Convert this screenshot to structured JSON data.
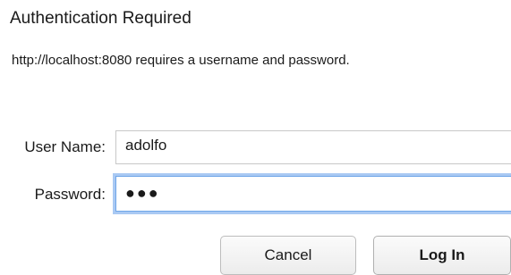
{
  "dialog": {
    "title": "Authentication Required",
    "message": "http://localhost:8080 requires a username and password."
  },
  "form": {
    "username": {
      "label": "User Name:",
      "value": "adolfo"
    },
    "password": {
      "label": "Password:",
      "masked_value": "●●●"
    }
  },
  "buttons": {
    "cancel_label": "Cancel",
    "login_label": "Log In"
  },
  "colors": {
    "focus_ring": "#a9c9f3",
    "focus_border": "#6fa6e8",
    "text": "#1a1a1a"
  }
}
